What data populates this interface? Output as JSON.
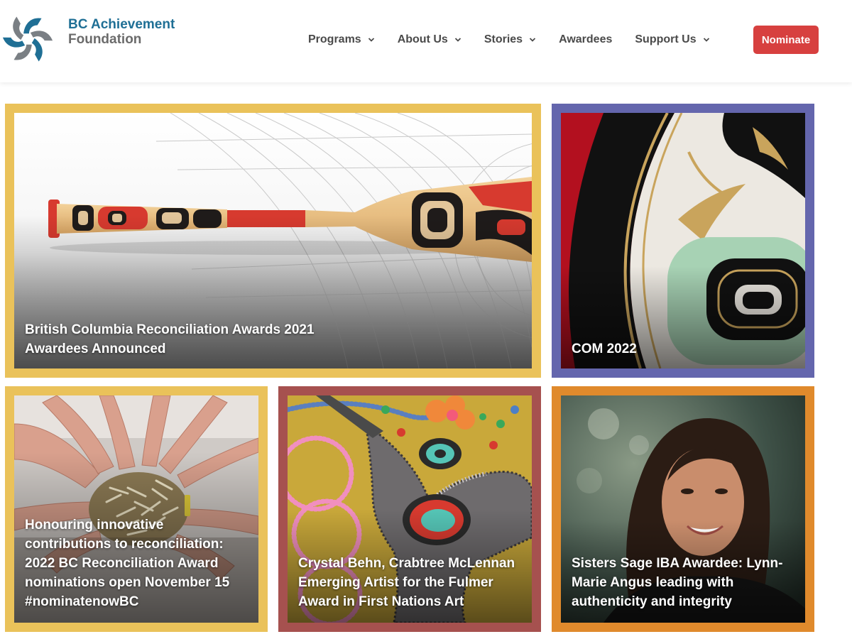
{
  "brand": {
    "line1": "BC Achievement",
    "line2": "Foundation",
    "colors": {
      "blue": "#1f6f95",
      "gray": "#6b6b6b",
      "accent": "#d7403f"
    }
  },
  "nav": {
    "items": [
      {
        "label": "Programs",
        "has_dropdown": true
      },
      {
        "label": "About Us",
        "has_dropdown": true
      },
      {
        "label": "Stories",
        "has_dropdown": true
      },
      {
        "label": "Awardees",
        "has_dropdown": false
      },
      {
        "label": "Support Us",
        "has_dropdown": true
      }
    ],
    "cta_label": "Nominate"
  },
  "cards": [
    {
      "title": "British Columbia Reconciliation Awards 2021 Awardees Announced",
      "frame_color": "#eac25a",
      "image": "carved-paddle-image"
    },
    {
      "title": "COM 2022",
      "frame_color": "#6466ad",
      "image": "formline-art-image"
    },
    {
      "title": "Honouring innovative contributions to reconciliation: 2022 BC Reconciliation Award nominations open November 15 #nominatenowBC",
      "frame_color": "#eac25a",
      "image": "hands-circle-image"
    },
    {
      "title": "Crystal Behn, Crabtree McLennan Emerging Artist for the Fulmer Award in First Nations Art",
      "frame_color": "#a6514f",
      "image": "beadwork-hummingbird-image"
    },
    {
      "title": "Sisters Sage IBA Awardee: Lynn-Marie Angus leading with authenticity and integrity",
      "frame_color": "#e08a2c",
      "image": "portrait-image"
    }
  ]
}
